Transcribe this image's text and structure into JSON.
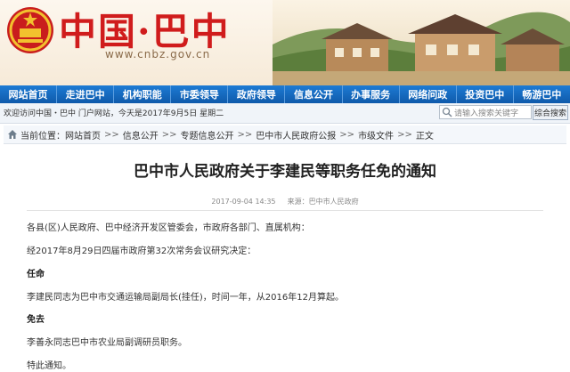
{
  "header": {
    "site_title": "中国·巴中",
    "site_url": "www.cnbz.gov.cn"
  },
  "nav": {
    "items": [
      "网站首页",
      "走进巴中",
      "机构职能",
      "市委领导",
      "政府领导",
      "信息公开",
      "办事服务",
      "网络问政",
      "投资巴中",
      "畅游巴中"
    ]
  },
  "infobar": {
    "text": "欢迎访问中国・巴中 门户网站，今天是2017年9月5日 星期二",
    "search_placeholder": "请输入搜索关键字",
    "search_button": "综合搜索"
  },
  "breadcrumb": {
    "label": "当前位置：",
    "items": [
      "网站首页",
      "信息公开",
      "专题信息公开",
      "巴中市人民政府公报",
      "市级文件",
      "正文"
    ]
  },
  "article": {
    "title": "巴中市人民政府关于李建民等职务任免的通知",
    "date": "2017-09-04 14:35",
    "source": "来源：巴中市人民政府",
    "salutation": "各县(区)人民政府、巴中经济开发区管委会，市政府各部门、直属机构：",
    "intro": "经2017年8月29日四届市政府第32次常务会议研究决定：",
    "appoint_heading": "任命",
    "appoint_text": "李建民同志为巴中市交通运输局副局长(挂任)，时间一年，从2016年12月算起。",
    "remove_heading": "免去",
    "remove_text": "李善永同志巴中市农业局副调研员职务。",
    "closing": "特此通知。"
  }
}
